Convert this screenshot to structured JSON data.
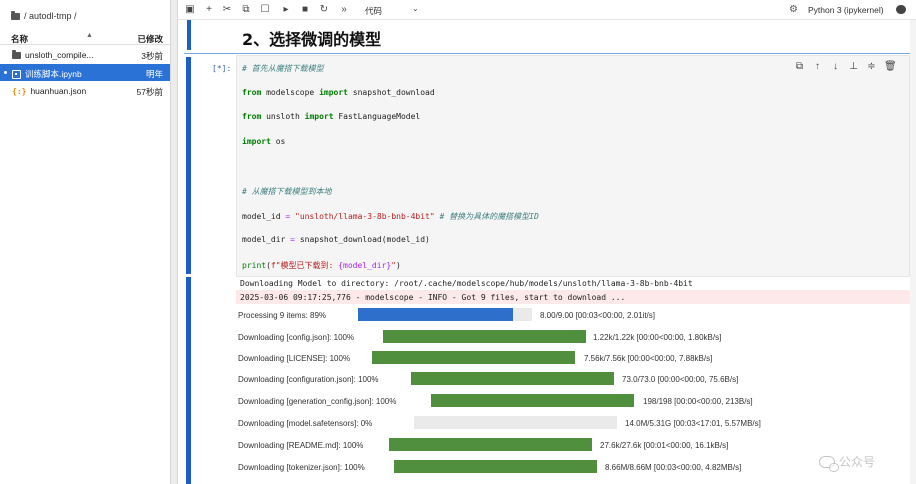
{
  "file_browser": {
    "path": "/ autodl-tmp /",
    "col_name": "名称",
    "sort_caret": "▲",
    "col_modified": "已修改",
    "items": [
      {
        "name": "unsloth_compile...",
        "modified": "3秒前",
        "icon": "folder-icon"
      },
      {
        "name": "训练脚本.ipynb",
        "modified": "明年",
        "icon": "notebook-icon",
        "selected": true
      },
      {
        "name": "huanhuan.json",
        "modified": "57秒前",
        "icon": "json-icon"
      }
    ]
  },
  "toolbar": {
    "icons": [
      "save-icon",
      "add-cell-icon",
      "cut-icon",
      "copy-icon",
      "paste-icon",
      "run-icon",
      "stop-icon",
      "restart-icon",
      "run-all-icon"
    ],
    "cell_type": "代码",
    "cell_type_caret": "⌄",
    "kernel_name": "Python 3 (ipykernel)"
  },
  "notebook": {
    "heading": "2、选择微调的模型",
    "in_prompt": "[*]:",
    "cell_toolbar_icons": [
      "duplicate-icon",
      "move-up-icon",
      "move-down-icon",
      "insert-below-icon",
      "format-icon",
      "delete-icon"
    ],
    "code": {
      "line1": "# 首先从魔搭下载模型",
      "line2_kw1": "from",
      "line2_mod": " modelscope ",
      "line2_kw2": "import",
      "line2_rest": " snapshot_download",
      "line3_kw1": "from",
      "line3_mod": " unsloth ",
      "line3_kw2": "import",
      "line3_rest": " FastLanguageModel",
      "line4_kw": "import",
      "line4_rest": " os",
      "line5": "# 从魔搭下载模型到本地",
      "line6_var": "model_id ",
      "line6_op": "=",
      "line6_str": " \"unsloth/llama-3-8b-bnb-4bit\"",
      "line6_comment": " # 替换为具体的魔搭模型ID",
      "line7_var": "model_dir ",
      "line7_op": "=",
      "line7_rest": " snapshot_download(model_id)",
      "line8_builtin": "print",
      "line8_rest1": "(",
      "line8_str": "f\"模型已下载到: ",
      "line8_interp": "{model_dir}",
      "line8_str_end": "\"",
      "line8_rest2": ")"
    },
    "output": {
      "stdout_line": "Downloading Model to directory: /root/.cache/modelscope/hub/models/unsloth/llama-3-8b-bnb-4bit",
      "stderr_line": "2025-03-06 09:17:25,776 - modelscope - INFO - Got 9 files, start to download ...",
      "progress": [
        {
          "label": "Processing  9  items:   89%",
          "fraction": 0.89,
          "color": "#2f6fcc",
          "stats": "8.00/9.00  [00:03<00:00,  2.01it/s]"
        },
        {
          "label": "Downloading  [config.json]:  100%",
          "fraction": 1.0,
          "color": "#4f8f3e",
          "stats": "1.22k/1.22k  [00:00<00:00,  1.80kB/s]"
        },
        {
          "label": "Downloading  [LICENSE]:  100%",
          "fraction": 1.0,
          "color": "#4f8f3e",
          "stats": "7.56k/7.56k  [00:00<00:00,  7.88kB/s]"
        },
        {
          "label": "Downloading  [configuration.json]:  100%",
          "fraction": 1.0,
          "color": "#4f8f3e",
          "stats": "73.0/73.0  [00:00<00:00,  75.6B/s]"
        },
        {
          "label": "Downloading  [generation_config.json]:  100%",
          "fraction": 1.0,
          "color": "#4f8f3e",
          "stats": "198/198  [00:00<00:00,  213B/s]"
        },
        {
          "label": "Downloading  [model.safetensors]:       0%",
          "fraction": 0.0,
          "color": "#4f8f3e",
          "stats": "14.0M/5.31G  [00:03<17:01,  5.57MB/s]"
        },
        {
          "label": "Downloading  [README.md]:  100%",
          "fraction": 1.0,
          "color": "#4f8f3e",
          "stats": "27.6k/27.6k  [00:01<00:00,  16.1kB/s]"
        },
        {
          "label": "Downloading  [tokenizer.json]:  100%",
          "fraction": 1.0,
          "color": "#4f8f3e",
          "stats": "8.66M/8.66M  [00:03<00:00,  4.82MB/s]"
        }
      ]
    },
    "watermark": "公众号"
  },
  "colors": {
    "accent": "#1d5fc6",
    "selected_row": "#2a72d6",
    "progress_blue": "#2f6fcc",
    "progress_green": "#4f8f3e",
    "stderr_bg": "#fde9ea"
  }
}
